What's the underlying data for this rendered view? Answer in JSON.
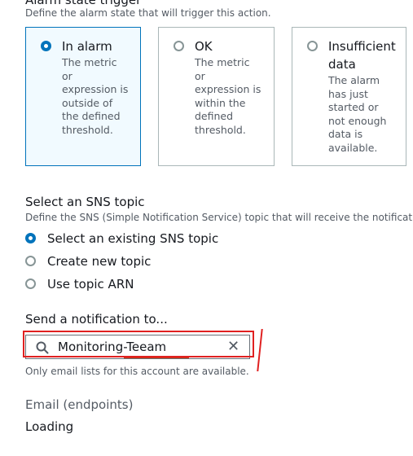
{
  "alarm_state": {
    "title": "Alarm state trigger",
    "description": "Define the alarm state that will trigger this action.",
    "tiles": [
      {
        "title": "In alarm",
        "desc_lines": [
          "The metric",
          "or",
          "expression is",
          "outside of",
          "the defined",
          "threshold."
        ],
        "selected": true
      },
      {
        "title": "OK",
        "desc_lines": [
          "The metric",
          "or",
          "expression is",
          "within the",
          "defined",
          "threshold."
        ],
        "selected": false
      },
      {
        "title_lines": [
          "Insufficient",
          "data"
        ],
        "desc_lines": [
          "The alarm",
          "has just",
          "started or",
          "not enough",
          "data is",
          "available."
        ],
        "selected": false
      }
    ]
  },
  "sns": {
    "title": "Select an SNS topic",
    "description": "Define the SNS (Simple Notification Service) topic that will receive the notificat",
    "options": [
      {
        "label": "Select an existing SNS topic",
        "selected": true
      },
      {
        "label": "Create new topic",
        "selected": false
      },
      {
        "label": "Use topic ARN",
        "selected": false
      }
    ]
  },
  "notify": {
    "label": "Send a notification to...",
    "value": "Monitoring-Teeam",
    "hint": "Only email lists for this account are available.",
    "icons": {
      "search": "search-icon",
      "clear": "close-icon"
    }
  },
  "endpoints": {
    "label": "Email (endpoints)",
    "status": "Loading"
  },
  "colors": {
    "accent": "#0073bb",
    "selected_tile_bg": "#f1faff",
    "annotation": "#e02020"
  }
}
